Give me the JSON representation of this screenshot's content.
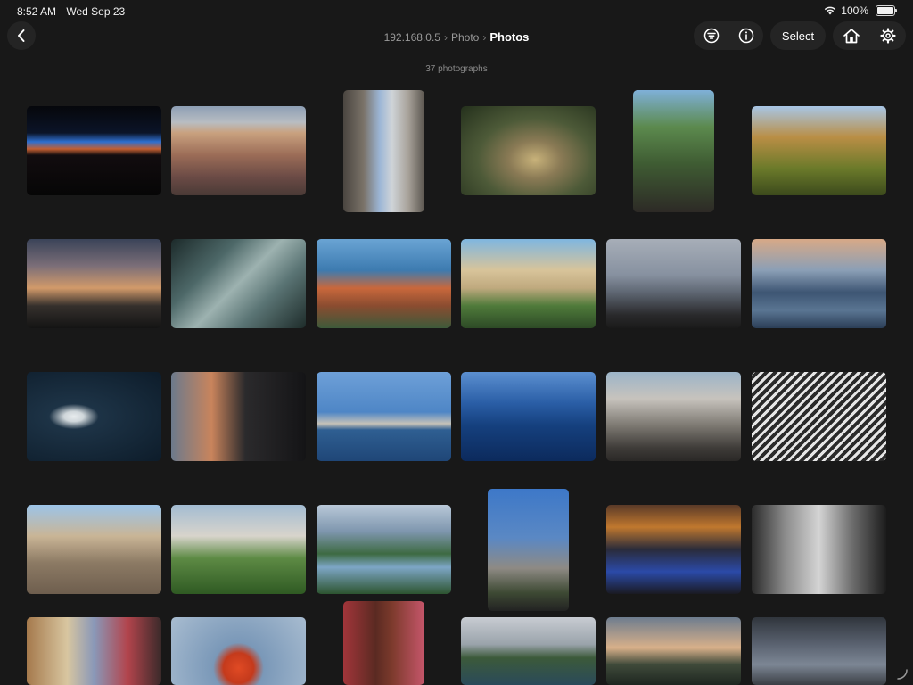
{
  "status": {
    "time": "8:52 AM",
    "date": "Wed Sep 23",
    "battery": "100%"
  },
  "navbar": {
    "breadcrumb": [
      {
        "label": "192.168.0.5"
      },
      {
        "label": "Photo"
      }
    ],
    "current": "Photos",
    "select_label": "Select",
    "icons": {
      "back": "chevron-left-icon",
      "filter": "filter-icon",
      "info": "info-icon",
      "home": "home-icon",
      "settings": "gear-icon"
    }
  },
  "count_label": "37 photographs",
  "photos": [
    {
      "name": "horizon-night",
      "bg": "linear-gradient(180deg,#06070b 0%,#0b1428 30%,#2e6fd0 40%,#c45f32 48%,#120c0f 55%,#060606 100%)"
    },
    {
      "name": "city-rooftops",
      "bg": "linear-gradient(180deg,#8d9eb4 0%,#b8bdc2 18%,#c9a17f 30%,#9b6c57 55%,#6a4a45 80%,#4a3a36 100%)"
    },
    {
      "name": "narrow-street",
      "bg": "linear-gradient(90deg,#4a4540 0%,#7a7268 25%,#9cb6d6 45%,#cfd4d8 60%,#a8a29a 80%,#5b564f 100%)"
    },
    {
      "name": "peacock",
      "bg": "radial-gradient(ellipse at 55% 60%,#c8b27a 0%,#8a7a55 25%,#4d5a38 55%,#24301c 100%)"
    },
    {
      "name": "terrace-trees",
      "bg": "linear-gradient(180deg,#7fb0d8 0%,#5c8a4e 30%,#3f5c33 60%,#2d2a26 100%)"
    },
    {
      "name": "tree-canopy",
      "bg": "linear-gradient(180deg,#a8c6e6 0%,#b98e45 35%,#6b7a2a 70%,#3c4a1c 100%)"
    },
    {
      "name": "palm-sunset",
      "bg": "linear-gradient(180deg,#3a4358 0%,#7b6e78 30%,#d29a6a 55%,#35302c 75%,#141414 100%)"
    },
    {
      "name": "fish-market",
      "bg": "linear-gradient(135deg,#1c2a2a 0%,#4d6868 30%,#9db2b0 50%,#5a7474 70%,#1e2c2a 100%)"
    },
    {
      "name": "coastal-cliffs",
      "bg": "linear-gradient(180deg,#6aa4d4 0%,#3d7bb0 35%,#c9683c 55%,#8a4c30 75%,#3d5a3a 100%)"
    },
    {
      "name": "villa-garden",
      "bg": "linear-gradient(180deg,#7fb6e0 0%,#d8c49a 35%,#bfa97e 55%,#4f7a3a 75%,#2d4a26 100%)"
    },
    {
      "name": "couple-lake",
      "bg": "linear-gradient(180deg,#a7aeb8 0%,#8791a0 40%,#5e6672 60%,#2a2a2c 85%,#1a1a1a 100%)"
    },
    {
      "name": "lake-promenade",
      "bg": "linear-gradient(180deg,#d7a987 0%,#8b9fb6 35%,#3d5573 60%,#5a7592 80%,#2b3e56 100%)"
    },
    {
      "name": "swan",
      "bg": "radial-gradient(ellipse at 35% 50%,#e8ecee 0%,#cfd6da 8%,#1d3346 20%,#0d1c2a 100%)"
    },
    {
      "name": "dark-building-dusk",
      "bg": "linear-gradient(90deg,#6c7a8c 0%,#c9845c 30%,#2b2a2c 55%,#141416 100%)"
    },
    {
      "name": "lake-fountain",
      "bg": "linear-gradient(180deg,#6ea0d8 0%,#4e86c6 45%,#c6c2b8 58%,#2f5f92 65%,#1f4677 100%)"
    },
    {
      "name": "blue-sea",
      "bg": "linear-gradient(180deg,#5b8fd0 0%,#2a5ea6 35%,#15407e 60%,#0c2a5c 100%)"
    },
    {
      "name": "modern-complex",
      "bg": "linear-gradient(180deg,#9cb4c8 0%,#c7c3bd 30%,#7d7972 60%,#3f3c39 85%,#2a2826 100%)"
    },
    {
      "name": "bw-pattern",
      "bg": "repeating-linear-gradient(135deg,#e6e6e6 0px,#e6e6e6 3px,#2a2a2a 3px,#2a2a2a 7px)"
    },
    {
      "name": "village-street",
      "bg": "linear-gradient(180deg,#9cc4e8 0%,#c9b596 35%,#8c7a64 65%,#6e5e4e 100%)"
    },
    {
      "name": "neuschwanstein",
      "bg": "linear-gradient(180deg,#a3bcd2 0%,#d8d4cc 35%,#5d8a44 60%,#2f5a23 100%)"
    },
    {
      "name": "alpine-lake",
      "bg": "linear-gradient(180deg,#b9c8d8 0%,#7e96ae 30%,#3d6a42 55%,#7da6c6 70%,#2d5430 100%)"
    },
    {
      "name": "skyscrapers",
      "bg": "linear-gradient(180deg,#3d78c8 0%,#5a88c4 40%,#8e8a84 65%,#3e4a34 85%,#222 100%)"
    },
    {
      "name": "hotel-lobby",
      "bg": "linear-gradient(180deg,#5a3a28 0%,#c0782e 25%,#2a2b3a 50%,#2b4aa8 75%,#1a1a22 100%)"
    },
    {
      "name": "bw-interior",
      "bg": "linear-gradient(90deg,#2a2a2a 0%,#8c8c8c 25%,#d4d4d4 50%,#6c6c6c 75%,#1c1c1c 100%)"
    },
    {
      "name": "festive-street",
      "bg": "linear-gradient(90deg,#a5794c 0%,#d8c6a0 30%,#8a98b8 50%,#b2444c 75%,#3a2a2a 100%)"
    },
    {
      "name": "lifebuoy",
      "bg": "radial-gradient(circle at 50% 75%,#e04a24 0%,#c43a1c 18%,#7a98b8 30%,#a8bcd0 100%)"
    },
    {
      "name": "red-door",
      "bg": "linear-gradient(90deg,#a2353a 0%,#5a2a22 40%,#7c3a2c 60%,#c5566a 100%)"
    },
    {
      "name": "sea-cliffs",
      "bg": "linear-gradient(180deg,#c8ccd2 0%,#9aa3ab 40%,#3c5a3a 60%,#2a4a5a 100%)"
    },
    {
      "name": "cliff-sunset",
      "bg": "linear-gradient(180deg,#6d7c8e 0%,#d8b08a 45%,#3f4a3a 70%,#1e2620 100%)"
    },
    {
      "name": "stormy-sky",
      "bg": "linear-gradient(180deg,#30353c 0%,#5a6270 40%,#7c8694 70%,#3a3e44 100%)"
    }
  ]
}
